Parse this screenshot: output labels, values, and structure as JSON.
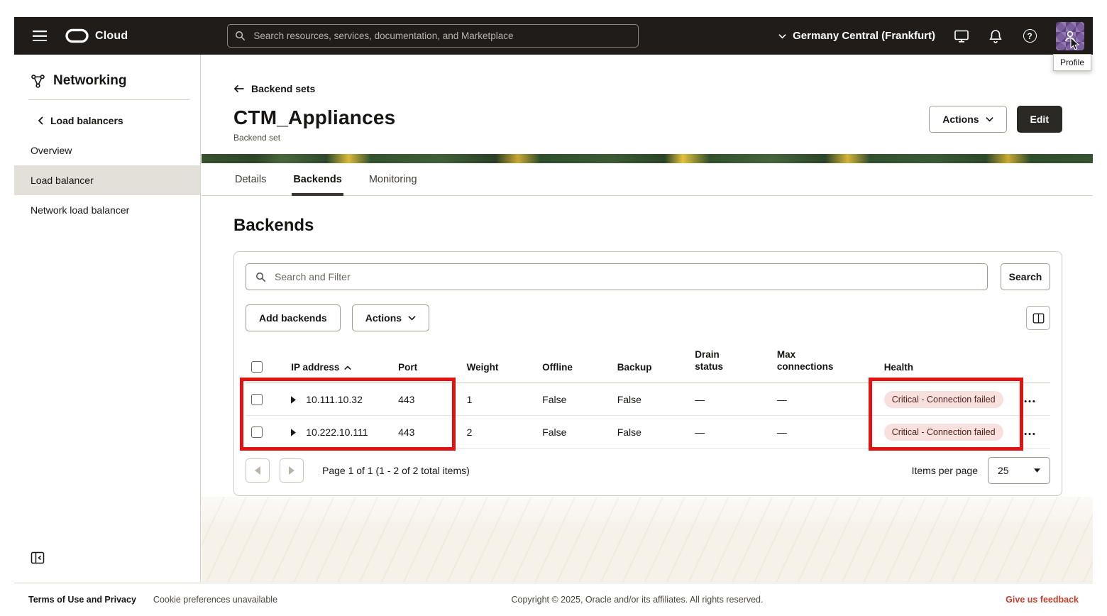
{
  "topbar": {
    "product": "Cloud",
    "search_placeholder": "Search resources, services, documentation, and Marketplace",
    "region": "Germany Central (Frankfurt)",
    "profile_tooltip": "Profile"
  },
  "sidebar": {
    "title": "Networking",
    "back_label": "Load balancers",
    "items": [
      {
        "label": "Overview",
        "active": false
      },
      {
        "label": "Load balancer",
        "active": true
      },
      {
        "label": "Network load balancer",
        "active": false
      }
    ]
  },
  "page": {
    "back_link": "Backend sets",
    "title": "CTM_Appliances",
    "subtitle": "Backend set",
    "actions_button": "Actions",
    "edit_button": "Edit",
    "tabs": [
      {
        "label": "Details",
        "active": false
      },
      {
        "label": "Backends",
        "active": true
      },
      {
        "label": "Monitoring",
        "active": false
      }
    ],
    "section_title": "Backends"
  },
  "toolbar": {
    "search_placeholder": "Search and Filter",
    "search_button": "Search",
    "add_button": "Add backends",
    "actions_button": "Actions"
  },
  "table": {
    "columns": [
      "IP address",
      "Port",
      "Weight",
      "Offline",
      "Backup",
      "Drain status",
      "Max connections",
      "Health"
    ],
    "sorted_column": "IP address",
    "sort_direction": "ascending",
    "rows": [
      {
        "ip": "10.111.10.32",
        "port": "443",
        "weight": "1",
        "offline": "False",
        "backup": "False",
        "drain": "—",
        "max": "—",
        "health": "Critical - Connection failed"
      },
      {
        "ip": "10.222.10.111",
        "port": "443",
        "weight": "2",
        "offline": "False",
        "backup": "False",
        "drain": "—",
        "max": "—",
        "health": "Critical - Connection failed"
      }
    ]
  },
  "pagination": {
    "label": "Page 1 of 1 (1 - 2 of 2 total items)",
    "items_per_page_label": "Items per page",
    "items_per_page_value": "25"
  },
  "footer": {
    "terms": "Terms of Use and Privacy",
    "cookies": "Cookie preferences unavailable",
    "copyright": "Copyright © 2025, Oracle and/or its affiliates. All rights reserved.",
    "feedback": "Give us feedback"
  },
  "colors": {
    "topbar_bg": "#1f1c19",
    "annotation_red": "#e01212",
    "health_badge_bg": "#f8e0de",
    "selected_nav_bg": "#e3dfd9",
    "oracle_red": "#c2402e",
    "primary_button_bg": "#2b2926"
  },
  "icons": {
    "search-icon": "magnifier",
    "chevron-down-icon": "v-chevron",
    "bell-icon": "notifications",
    "help-icon": "question-circle",
    "person-icon": "profile",
    "grid-columns-icon": "column-preferences",
    "networking-icon": "network-nodes"
  }
}
